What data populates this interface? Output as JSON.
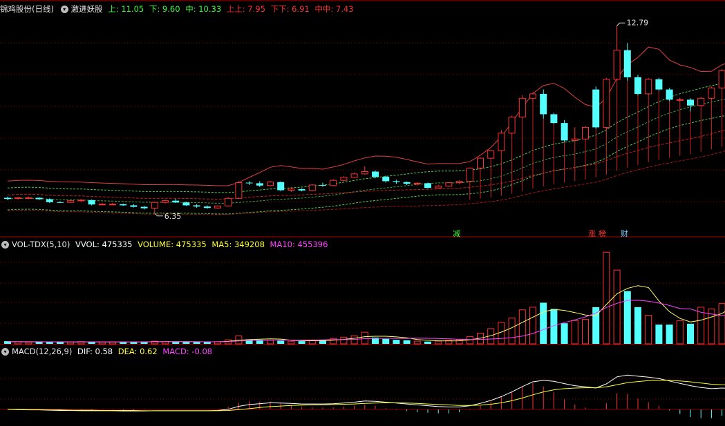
{
  "main_panel": {
    "stock_name": "锦鸡股份(日线)",
    "indicator_name": "激进妖股",
    "values": [
      {
        "label": "上: 11.05",
        "color": "#3dff3d"
      },
      {
        "label": "下: 9.60",
        "color": "#3dff3d"
      },
      {
        "label": "中: 10.33",
        "color": "#3dff3d"
      },
      {
        "label": "上上: 7.95",
        "color": "#ff3333"
      },
      {
        "label": "下下: 6.91",
        "color": "#ff3333"
      },
      {
        "label": "中中: 7.43",
        "color": "#ff3333"
      }
    ],
    "max_label": "12.79",
    "min_label": "6.35",
    "event_tags": [
      {
        "text": "减",
        "color": "#3dff3d"
      },
      {
        "text": "涨",
        "color": "#ff3333"
      },
      {
        "text": "榜",
        "color": "#ff3333"
      },
      {
        "text": "财",
        "color": "#66ccff"
      }
    ]
  },
  "vol_panel": {
    "name": "VOL-TDX(5,10)",
    "values": [
      {
        "label": "VVOL: 475335",
        "color": "#ffffff"
      },
      {
        "label": "VOLUME: 475335",
        "color": "#ffff33"
      },
      {
        "label": "MA5: 349208",
        "color": "#ffff33"
      },
      {
        "label": "MA10: 455396",
        "color": "#ff44ff"
      }
    ]
  },
  "macd_panel": {
    "name": "MACD(12,26,9)",
    "values": [
      {
        "label": "DIF: 0.58",
        "color": "#ffffff"
      },
      {
        "label": "DEA: 0.62",
        "color": "#ffff33"
      },
      {
        "label": "MACD: -0.08",
        "color": "#ff44ff"
      }
    ]
  },
  "colors": {
    "background": "#000000",
    "up_candle": "#ff3333",
    "down_candle": "#54ffff",
    "grid": "#8b0000"
  },
  "chart_data": {
    "type": "candlestick",
    "price_range": [
      5.8,
      13.2
    ],
    "candles": [
      [
        6.88,
        6.92,
        6.8,
        6.84
      ],
      [
        6.86,
        6.9,
        6.82,
        6.88
      ],
      [
        6.88,
        6.92,
        6.85,
        6.88
      ],
      [
        6.88,
        6.9,
        6.8,
        6.83
      ],
      [
        6.83,
        6.86,
        6.7,
        6.73
      ],
      [
        6.73,
        6.76,
        6.7,
        6.72
      ],
      [
        6.72,
        6.8,
        6.7,
        6.78
      ],
      [
        6.78,
        6.83,
        6.75,
        6.8
      ],
      [
        6.8,
        6.82,
        6.62,
        6.65
      ],
      [
        6.65,
        6.7,
        6.62,
        6.66
      ],
      [
        6.66,
        6.7,
        6.64,
        6.66
      ],
      [
        6.66,
        6.68,
        6.6,
        6.62
      ],
      [
        6.62,
        6.66,
        6.55,
        6.57
      ],
      [
        6.57,
        6.6,
        6.48,
        6.52
      ],
      [
        6.52,
        6.75,
        6.35,
        6.72
      ],
      [
        6.72,
        6.82,
        6.68,
        6.78
      ],
      [
        6.78,
        6.85,
        6.7,
        6.72
      ],
      [
        6.72,
        6.75,
        6.6,
        6.62
      ],
      [
        6.62,
        6.66,
        6.54,
        6.58
      ],
      [
        6.58,
        6.62,
        6.5,
        6.53
      ],
      [
        6.53,
        6.62,
        6.5,
        6.6
      ],
      [
        6.6,
        6.9,
        6.58,
        6.86
      ],
      [
        6.86,
        7.45,
        6.84,
        7.4
      ],
      [
        7.4,
        7.45,
        7.32,
        7.38
      ],
      [
        7.38,
        7.45,
        7.25,
        7.3
      ],
      [
        7.3,
        7.46,
        7.28,
        7.42
      ],
      [
        7.42,
        7.44,
        7.1,
        7.14
      ],
      [
        7.14,
        7.22,
        7.08,
        7.18
      ],
      [
        7.18,
        7.2,
        7.1,
        7.13
      ],
      [
        7.13,
        7.35,
        7.1,
        7.32
      ],
      [
        7.32,
        7.4,
        7.26,
        7.3
      ],
      [
        7.3,
        7.52,
        7.28,
        7.48
      ],
      [
        7.48,
        7.62,
        7.45,
        7.58
      ],
      [
        7.58,
        7.74,
        7.56,
        7.7
      ],
      [
        7.7,
        7.96,
        7.68,
        7.78
      ],
      [
        7.78,
        7.82,
        7.55,
        7.6
      ],
      [
        7.6,
        7.64,
        7.4,
        7.45
      ],
      [
        7.45,
        7.5,
        7.36,
        7.42
      ],
      [
        7.42,
        7.44,
        7.32,
        7.36
      ],
      [
        7.36,
        7.42,
        7.3,
        7.38
      ],
      [
        7.38,
        7.4,
        7.2,
        7.22
      ],
      [
        7.22,
        7.32,
        7.2,
        7.28
      ],
      [
        7.28,
        7.42,
        7.26,
        7.4
      ],
      [
        7.4,
        7.48,
        7.35,
        7.45
      ],
      [
        7.45,
        7.92,
        7.43,
        7.9
      ],
      [
        7.9,
        8.26,
        7.88,
        8.24
      ],
      [
        8.24,
        8.52,
        8.22,
        8.5
      ],
      [
        8.5,
        9.2,
        8.48,
        9.1
      ],
      [
        9.1,
        9.7,
        9.05,
        9.65
      ],
      [
        9.65,
        10.4,
        9.6,
        10.3
      ],
      [
        10.3,
        10.5,
        10.15,
        10.45
      ],
      [
        10.45,
        10.6,
        9.6,
        9.75
      ],
      [
        9.75,
        9.8,
        9.4,
        9.45
      ],
      [
        9.45,
        9.55,
        8.8,
        8.85
      ],
      [
        8.85,
        9.3,
        8.8,
        8.9
      ],
      [
        8.9,
        9.35,
        8.85,
        9.3
      ],
      [
        10.6,
        10.7,
        9.25,
        9.3
      ],
      [
        9.3,
        11.0,
        9.2,
        10.95
      ],
      [
        10.95,
        12.79,
        10.9,
        11.95
      ],
      [
        11.95,
        12.2,
        10.9,
        11.02
      ],
      [
        11.02,
        11.1,
        10.4,
        10.45
      ],
      [
        10.45,
        11.0,
        10.4,
        10.95
      ],
      [
        10.95,
        11.0,
        10.55,
        10.6
      ],
      [
        10.6,
        10.65,
        10.2,
        10.25
      ],
      [
        10.25,
        10.32,
        10.18,
        10.25
      ],
      [
        10.25,
        10.3,
        9.85,
        10.05
      ],
      [
        10.05,
        10.35,
        10.0,
        10.3
      ],
      [
        10.3,
        10.7,
        10.25,
        10.65
      ],
      [
        10.65,
        11.3,
        10.6,
        11.25
      ],
      [
        11.25,
        11.3,
        10.75,
        10.9
      ]
    ],
    "volumes": [
      6,
      5,
      4,
      4,
      5,
      4,
      4,
      5,
      4,
      4,
      4,
      4,
      4,
      5,
      6,
      5,
      4,
      4,
      4,
      4,
      5,
      9,
      18,
      10,
      9,
      8,
      7,
      6,
      6,
      8,
      9,
      12,
      15,
      18,
      26,
      14,
      11,
      9,
      8,
      6,
      5,
      6,
      8,
      9,
      16,
      24,
      34,
      48,
      58,
      76,
      82,
      92,
      78,
      46,
      52,
      55,
      82,
      205,
      165,
      118,
      82,
      64,
      43,
      43,
      52,
      45,
      82,
      78,
      90,
      118
    ],
    "vol_range": [
      0,
      210
    ],
    "vol_ma5": [
      4.8,
      4.7,
      4.6,
      4.5,
      4.6,
      4.4,
      4.3,
      4.4,
      4.4,
      4.3,
      4.2,
      4.1,
      4.2,
      4.4,
      4.8,
      5.0,
      5.0,
      4.9,
      4.8,
      4.7,
      4.7,
      5.5,
      8.0,
      9.4,
      10.3,
      11.2,
      10.6,
      8.0,
      7.2,
      7.0,
      7.2,
      8.2,
      10.0,
      12.4,
      16.0,
      17.0,
      17.0,
      15.6,
      13.6,
      9.6,
      7.8,
      6.8,
      6.6,
      6.8,
      8.8,
      12.6,
      18.2,
      26.2,
      36.0,
      48.0,
      59.6,
      71.2,
      77.2,
      74.8,
      70.0,
      64.6,
      62.6,
      88.0,
      112,
      124,
      130,
      126,
      96,
      72,
      57,
      49,
      53,
      60,
      68,
      82
    ],
    "vol_ma10": [
      5.0,
      5.0,
      4.9,
      4.8,
      4.7,
      4.6,
      4.5,
      4.5,
      4.5,
      4.4,
      4.4,
      4.3,
      4.3,
      4.3,
      4.5,
      4.6,
      4.7,
      4.7,
      4.6,
      4.6,
      4.7,
      5.1,
      6.4,
      7.2,
      7.6,
      8.0,
      8.3,
      8.5,
      8.5,
      8.6,
      8.9,
      9.4,
      9.6,
      9.9,
      11.6,
      12.0,
      12.4,
      12.2,
      12.2,
      12.8,
      12.4,
      11.9,
      11.1,
      10.2,
      9.8,
      10.0,
      10.8,
      12.0,
      13.9,
      17.3,
      23.2,
      31.8,
      40.6,
      47.5,
      53.6,
      60.2,
      69.0,
      81.3,
      90.6,
      97.2,
      97.5,
      95.3,
      91.2,
      85.9,
      78.9,
      78.0,
      70.5,
      66.8,
      63.2,
      65.0
    ],
    "macd_range": [
      -0.45,
      1.75
    ],
    "dif": [
      0.0,
      -0.01,
      -0.02,
      -0.02,
      -0.03,
      -0.04,
      -0.04,
      -0.05,
      -0.05,
      -0.05,
      -0.05,
      -0.06,
      -0.06,
      -0.06,
      -0.05,
      -0.05,
      -0.05,
      -0.05,
      -0.05,
      -0.05,
      -0.04,
      0.0,
      0.1,
      0.16,
      0.19,
      0.22,
      0.21,
      0.2,
      0.18,
      0.18,
      0.18,
      0.19,
      0.21,
      0.24,
      0.28,
      0.27,
      0.24,
      0.21,
      0.18,
      0.15,
      0.12,
      0.09,
      0.08,
      0.08,
      0.12,
      0.2,
      0.3,
      0.43,
      0.59,
      0.77,
      0.93,
      0.98,
      0.95,
      0.87,
      0.8,
      0.76,
      0.72,
      0.86,
      1.1,
      1.16,
      1.12,
      1.09,
      1.04,
      0.96,
      0.88,
      0.8,
      0.74,
      0.7,
      0.72,
      0.7
    ],
    "dea": [
      0.0,
      0.0,
      -0.01,
      -0.01,
      -0.02,
      -0.02,
      -0.03,
      -0.03,
      -0.03,
      -0.04,
      -0.04,
      -0.04,
      -0.04,
      -0.05,
      -0.05,
      -0.05,
      -0.05,
      -0.05,
      -0.05,
      -0.05,
      -0.05,
      -0.04,
      -0.01,
      0.02,
      0.06,
      0.09,
      0.11,
      0.13,
      0.14,
      0.15,
      0.15,
      0.16,
      0.17,
      0.18,
      0.2,
      0.21,
      0.22,
      0.22,
      0.21,
      0.2,
      0.18,
      0.16,
      0.15,
      0.13,
      0.13,
      0.14,
      0.17,
      0.22,
      0.29,
      0.38,
      0.49,
      0.59,
      0.66,
      0.7,
      0.72,
      0.73,
      0.73,
      0.76,
      0.83,
      0.9,
      0.94,
      0.97,
      0.98,
      0.98,
      0.96,
      0.93,
      0.89,
      0.85,
      0.83,
      0.82
    ],
    "macd_hist": [
      0.0,
      -0.02,
      -0.02,
      -0.02,
      -0.02,
      -0.04,
      -0.02,
      -0.04,
      -0.04,
      -0.02,
      -0.02,
      -0.04,
      -0.04,
      -0.02,
      0.0,
      0.0,
      0.0,
      0.0,
      0.0,
      0.0,
      0.02,
      0.08,
      0.22,
      0.28,
      0.26,
      0.26,
      0.2,
      0.14,
      0.08,
      0.06,
      0.06,
      0.06,
      0.08,
      0.12,
      0.16,
      0.12,
      0.04,
      -0.02,
      -0.06,
      -0.1,
      -0.12,
      -0.14,
      -0.14,
      -0.1,
      -0.02,
      0.12,
      0.26,
      0.42,
      0.6,
      0.78,
      0.88,
      0.78,
      0.58,
      0.34,
      0.16,
      0.06,
      -0.02,
      0.2,
      0.54,
      0.52,
      0.36,
      0.24,
      0.12,
      -0.04,
      -0.16,
      -0.26,
      -0.3,
      -0.3,
      -0.22,
      -0.24
    ]
  }
}
